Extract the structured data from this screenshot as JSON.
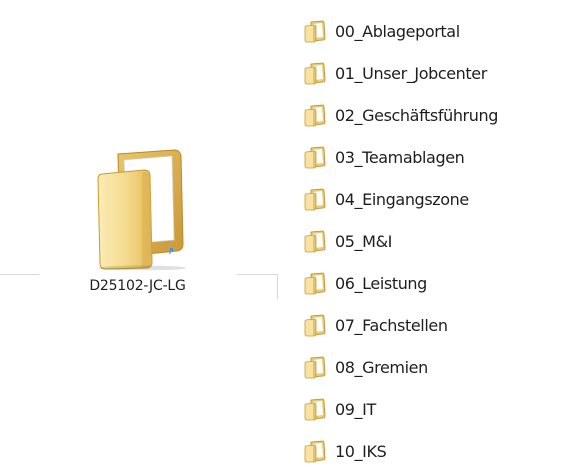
{
  "big_folder": {
    "icon": "folder-large-icon",
    "label": "D25102-JC-LG"
  },
  "folders": [
    {
      "icon": "folder-icon",
      "name": "00_Ablageportal"
    },
    {
      "icon": "folder-icon",
      "name": "01_Unser_Jobcenter"
    },
    {
      "icon": "folder-icon",
      "name": "02_Geschäftsführung"
    },
    {
      "icon": "folder-icon",
      "name": "03_Teamablagen"
    },
    {
      "icon": "folder-icon",
      "name": "04_Eingangszone"
    },
    {
      "icon": "folder-icon",
      "name": "05_M&I"
    },
    {
      "icon": "folder-icon",
      "name": "06_Leistung"
    },
    {
      "icon": "folder-icon",
      "name": "07_Fachstellen"
    },
    {
      "icon": "folder-icon",
      "name": "08_Gremien"
    },
    {
      "icon": "folder-icon",
      "name": "09_IT"
    },
    {
      "icon": "folder-icon",
      "name": "10_IKS"
    }
  ],
  "colors": {
    "folder_light": "#f7e3a1",
    "folder_mid": "#ecc96b",
    "folder_dark": "#c99a35",
    "folder_edge": "#b88a2a",
    "paper": "#ffffff",
    "label_border": "#d9d9d9"
  }
}
